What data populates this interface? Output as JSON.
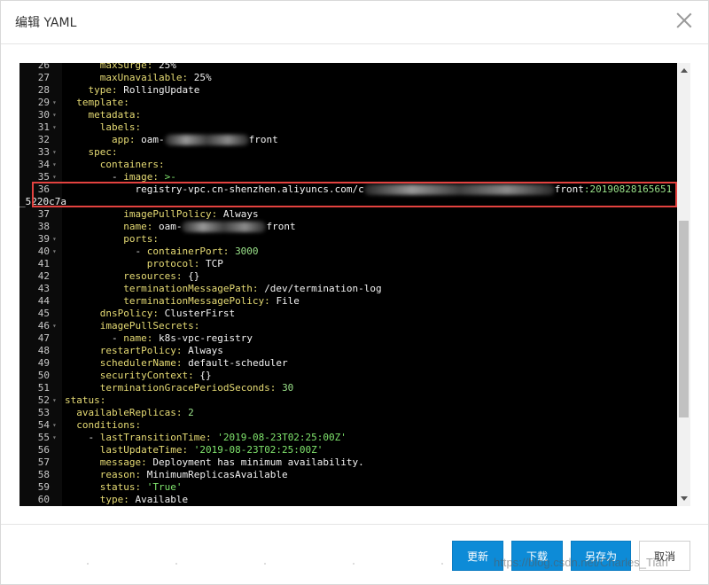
{
  "dialog": {
    "title": "编辑 YAML"
  },
  "editor": {
    "lines": [
      {
        "n": "26",
        "fold": "",
        "segs": [
          {
            "t": "      "
          },
          {
            "t": "maxSurge:",
            "c": "key"
          },
          {
            "t": " "
          },
          {
            "t": "25%",
            "c": "plain"
          }
        ]
      },
      {
        "n": "27",
        "fold": "",
        "segs": [
          {
            "t": "      "
          },
          {
            "t": "maxUnavailable:",
            "c": "key"
          },
          {
            "t": " "
          },
          {
            "t": "25%",
            "c": "plain"
          }
        ]
      },
      {
        "n": "28",
        "fold": "",
        "segs": [
          {
            "t": "    "
          },
          {
            "t": "type:",
            "c": "key"
          },
          {
            "t": " "
          },
          {
            "t": "RollingUpdate",
            "c": "plain"
          }
        ]
      },
      {
        "n": "29",
        "fold": "▾",
        "segs": [
          {
            "t": "  "
          },
          {
            "t": "template:",
            "c": "key"
          }
        ]
      },
      {
        "n": "30",
        "fold": "▾",
        "segs": [
          {
            "t": "    "
          },
          {
            "t": "metadata:",
            "c": "key"
          }
        ]
      },
      {
        "n": "31",
        "fold": "▾",
        "segs": [
          {
            "t": "      "
          },
          {
            "t": "labels:",
            "c": "key"
          }
        ]
      },
      {
        "n": "32",
        "fold": "",
        "segs": [
          {
            "t": "        "
          },
          {
            "t": "app:",
            "c": "key"
          },
          {
            "t": " "
          },
          {
            "t": "oam-",
            "c": "plain"
          },
          {
            "blur": 95
          },
          {
            "t": "front",
            "c": "plain"
          }
        ]
      },
      {
        "n": "33",
        "fold": "▾",
        "segs": [
          {
            "t": "    "
          },
          {
            "t": "spec:",
            "c": "key"
          }
        ]
      },
      {
        "n": "34",
        "fold": "▾",
        "segs": [
          {
            "t": "      "
          },
          {
            "t": "containers:",
            "c": "key"
          }
        ]
      },
      {
        "n": "35",
        "fold": "▾",
        "segs": [
          {
            "t": "        - "
          },
          {
            "t": "image:",
            "c": "key"
          },
          {
            "t": " "
          },
          {
            "t": ">-",
            "c": "str"
          }
        ]
      },
      {
        "n": "36",
        "fold": "",
        "segs": [
          {
            "t": "            "
          },
          {
            "t": "registry-vpc.cn-shenzhen.aliyuncs.com/c",
            "c": "plain"
          },
          {
            "blur": 215
          },
          {
            "t": "front",
            "c": "plain"
          },
          {
            "t": ":20190828165651",
            "c": "num"
          }
        ]
      },
      {
        "n": "",
        "fold": "",
        "segs": [
          {
            "t": "_5220c7a",
            "c": "plain"
          }
        ],
        "shift": -51
      },
      {
        "n": "37",
        "fold": "",
        "segs": [
          {
            "t": "          "
          },
          {
            "t": "imagePullPolicy:",
            "c": "key"
          },
          {
            "t": " "
          },
          {
            "t": "Always",
            "c": "plain"
          }
        ]
      },
      {
        "n": "38",
        "fold": "",
        "segs": [
          {
            "t": "          "
          },
          {
            "t": "name:",
            "c": "key"
          },
          {
            "t": " "
          },
          {
            "t": "oam-",
            "c": "plain"
          },
          {
            "blur": 95
          },
          {
            "t": "front",
            "c": "plain"
          }
        ]
      },
      {
        "n": "39",
        "fold": "▾",
        "segs": [
          {
            "t": "          "
          },
          {
            "t": "ports:",
            "c": "key"
          }
        ]
      },
      {
        "n": "40",
        "fold": "▾",
        "segs": [
          {
            "t": "            - "
          },
          {
            "t": "containerPort:",
            "c": "key"
          },
          {
            "t": " "
          },
          {
            "t": "3000",
            "c": "num"
          }
        ]
      },
      {
        "n": "41",
        "fold": "",
        "segs": [
          {
            "t": "              "
          },
          {
            "t": "protocol:",
            "c": "key"
          },
          {
            "t": " "
          },
          {
            "t": "TCP",
            "c": "plain"
          }
        ]
      },
      {
        "n": "42",
        "fold": "",
        "segs": [
          {
            "t": "          "
          },
          {
            "t": "resources:",
            "c": "key"
          },
          {
            "t": " "
          },
          {
            "t": "{}",
            "c": "plain"
          }
        ]
      },
      {
        "n": "43",
        "fold": "",
        "segs": [
          {
            "t": "          "
          },
          {
            "t": "terminationMessagePath:",
            "c": "key"
          },
          {
            "t": " "
          },
          {
            "t": "/dev/termination-log",
            "c": "plain"
          }
        ]
      },
      {
        "n": "44",
        "fold": "",
        "segs": [
          {
            "t": "          "
          },
          {
            "t": "terminationMessagePolicy:",
            "c": "key"
          },
          {
            "t": " "
          },
          {
            "t": "File",
            "c": "plain"
          }
        ]
      },
      {
        "n": "45",
        "fold": "",
        "segs": [
          {
            "t": "      "
          },
          {
            "t": "dnsPolicy:",
            "c": "key"
          },
          {
            "t": " "
          },
          {
            "t": "ClusterFirst",
            "c": "plain"
          }
        ]
      },
      {
        "n": "46",
        "fold": "▾",
        "segs": [
          {
            "t": "      "
          },
          {
            "t": "imagePullSecrets:",
            "c": "key"
          }
        ]
      },
      {
        "n": "47",
        "fold": "",
        "segs": [
          {
            "t": "        - "
          },
          {
            "t": "name:",
            "c": "key"
          },
          {
            "t": " "
          },
          {
            "t": "k8s-vpc-registry",
            "c": "plain"
          }
        ]
      },
      {
        "n": "48",
        "fold": "",
        "segs": [
          {
            "t": "      "
          },
          {
            "t": "restartPolicy:",
            "c": "key"
          },
          {
            "t": " "
          },
          {
            "t": "Always",
            "c": "plain"
          }
        ]
      },
      {
        "n": "49",
        "fold": "",
        "segs": [
          {
            "t": "      "
          },
          {
            "t": "schedulerName:",
            "c": "key"
          },
          {
            "t": " "
          },
          {
            "t": "default-scheduler",
            "c": "plain"
          }
        ]
      },
      {
        "n": "50",
        "fold": "",
        "segs": [
          {
            "t": "      "
          },
          {
            "t": "securityContext:",
            "c": "key"
          },
          {
            "t": " "
          },
          {
            "t": "{}",
            "c": "plain"
          }
        ]
      },
      {
        "n": "51",
        "fold": "",
        "segs": [
          {
            "t": "      "
          },
          {
            "t": "terminationGracePeriodSeconds:",
            "c": "key"
          },
          {
            "t": " "
          },
          {
            "t": "30",
            "c": "num"
          }
        ]
      },
      {
        "n": "52",
        "fold": "▾",
        "segs": [
          {
            "t": "status:",
            "c": "key"
          }
        ]
      },
      {
        "n": "53",
        "fold": "",
        "segs": [
          {
            "t": "  "
          },
          {
            "t": "availableReplicas:",
            "c": "key"
          },
          {
            "t": " "
          },
          {
            "t": "2",
            "c": "num"
          }
        ]
      },
      {
        "n": "54",
        "fold": "▾",
        "segs": [
          {
            "t": "  "
          },
          {
            "t": "conditions:",
            "c": "key"
          }
        ]
      },
      {
        "n": "55",
        "fold": "▾",
        "segs": [
          {
            "t": "    - "
          },
          {
            "t": "lastTransitionTime:",
            "c": "key"
          },
          {
            "t": " "
          },
          {
            "t": "'2019-08-23T02:25:00Z'",
            "c": "str"
          }
        ]
      },
      {
        "n": "56",
        "fold": "",
        "segs": [
          {
            "t": "      "
          },
          {
            "t": "lastUpdateTime:",
            "c": "key"
          },
          {
            "t": " "
          },
          {
            "t": "'2019-08-23T02:25:00Z'",
            "c": "str"
          }
        ]
      },
      {
        "n": "57",
        "fold": "",
        "segs": [
          {
            "t": "      "
          },
          {
            "t": "message:",
            "c": "key"
          },
          {
            "t": " "
          },
          {
            "t": "Deployment has minimum availability.",
            "c": "plain"
          }
        ]
      },
      {
        "n": "58",
        "fold": "",
        "segs": [
          {
            "t": "      "
          },
          {
            "t": "reason:",
            "c": "key"
          },
          {
            "t": " "
          },
          {
            "t": "MinimumReplicasAvailable",
            "c": "plain"
          }
        ]
      },
      {
        "n": "59",
        "fold": "",
        "segs": [
          {
            "t": "      "
          },
          {
            "t": "status:",
            "c": "key"
          },
          {
            "t": " "
          },
          {
            "t": "'True'",
            "c": "str"
          }
        ]
      },
      {
        "n": "60",
        "fold": "",
        "segs": [
          {
            "t": "      "
          },
          {
            "t": "type:",
            "c": "key"
          },
          {
            "t": " "
          },
          {
            "t": "Available",
            "c": "plain"
          }
        ]
      }
    ]
  },
  "buttons": {
    "update": "更新",
    "download": "下载",
    "save_as": "另存为",
    "cancel": "取消"
  },
  "watermark": "https://blog.csdn.net/Charles_Tian",
  "colors": {
    "primary": "#0d8bd7",
    "highlight_border": "#e3423f",
    "editor_bg": "#000000",
    "key": "#e6db74",
    "number": "#9be38a",
    "string": "#7fe36c"
  },
  "icons": {
    "close": "close-icon",
    "scroll_up": "chevron-up-icon",
    "scroll_down": "chevron-down-icon"
  }
}
